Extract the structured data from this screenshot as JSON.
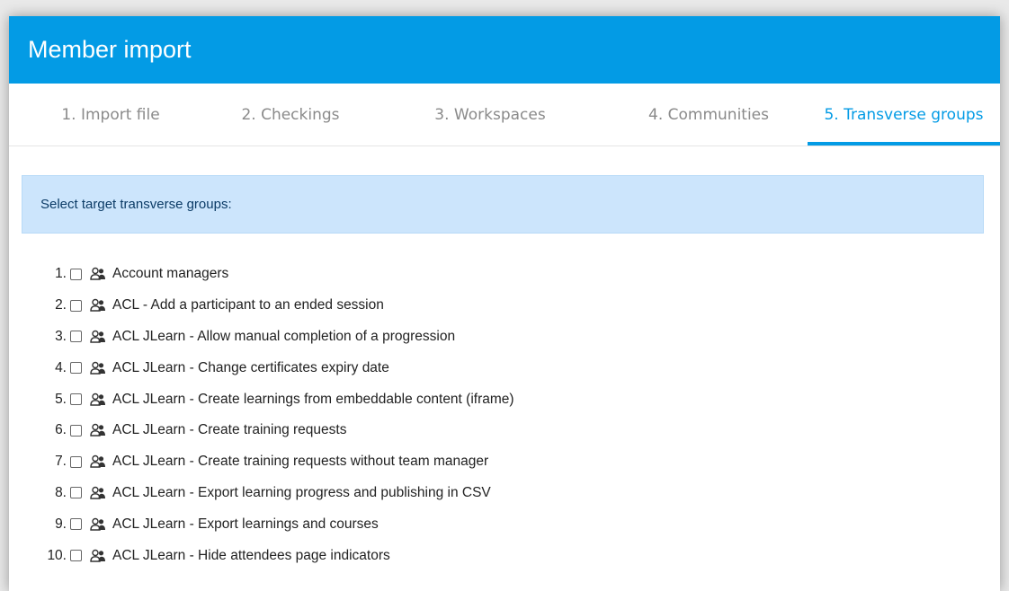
{
  "modal": {
    "title": "Member import"
  },
  "tabs": [
    {
      "label": "1. Import file"
    },
    {
      "label": "2. Checkings"
    },
    {
      "label": "3. Workspaces"
    },
    {
      "label": "4. Communities"
    },
    {
      "label": "5. Transverse groups",
      "active": true
    }
  ],
  "alert": {
    "text": "Select target transverse groups:"
  },
  "groups": [
    {
      "num": "1.",
      "label": "Account managers"
    },
    {
      "num": "2.",
      "label": "ACL - Add a participant to an ended session"
    },
    {
      "num": "3.",
      "label": "ACL JLearn - Allow manual completion of a progression"
    },
    {
      "num": "4.",
      "label": "ACL JLearn - Change certificates expiry date"
    },
    {
      "num": "5.",
      "label": "ACL JLearn - Create learnings from embeddable content (iframe)"
    },
    {
      "num": "6.",
      "label": "ACL JLearn - Create training requests"
    },
    {
      "num": "7.",
      "label": "ACL JLearn - Create training requests without team manager"
    },
    {
      "num": "8.",
      "label": "ACL JLearn - Export learning progress and publishing in CSV"
    },
    {
      "num": "9.",
      "label": "ACL JLearn - Export learnings and courses"
    },
    {
      "num": "10.",
      "label": "ACL JLearn - Hide attendees page indicators"
    }
  ],
  "colors": {
    "accent": "#039be5",
    "alert_bg": "#cce5fc"
  },
  "icons": {
    "group": "group-icon"
  }
}
